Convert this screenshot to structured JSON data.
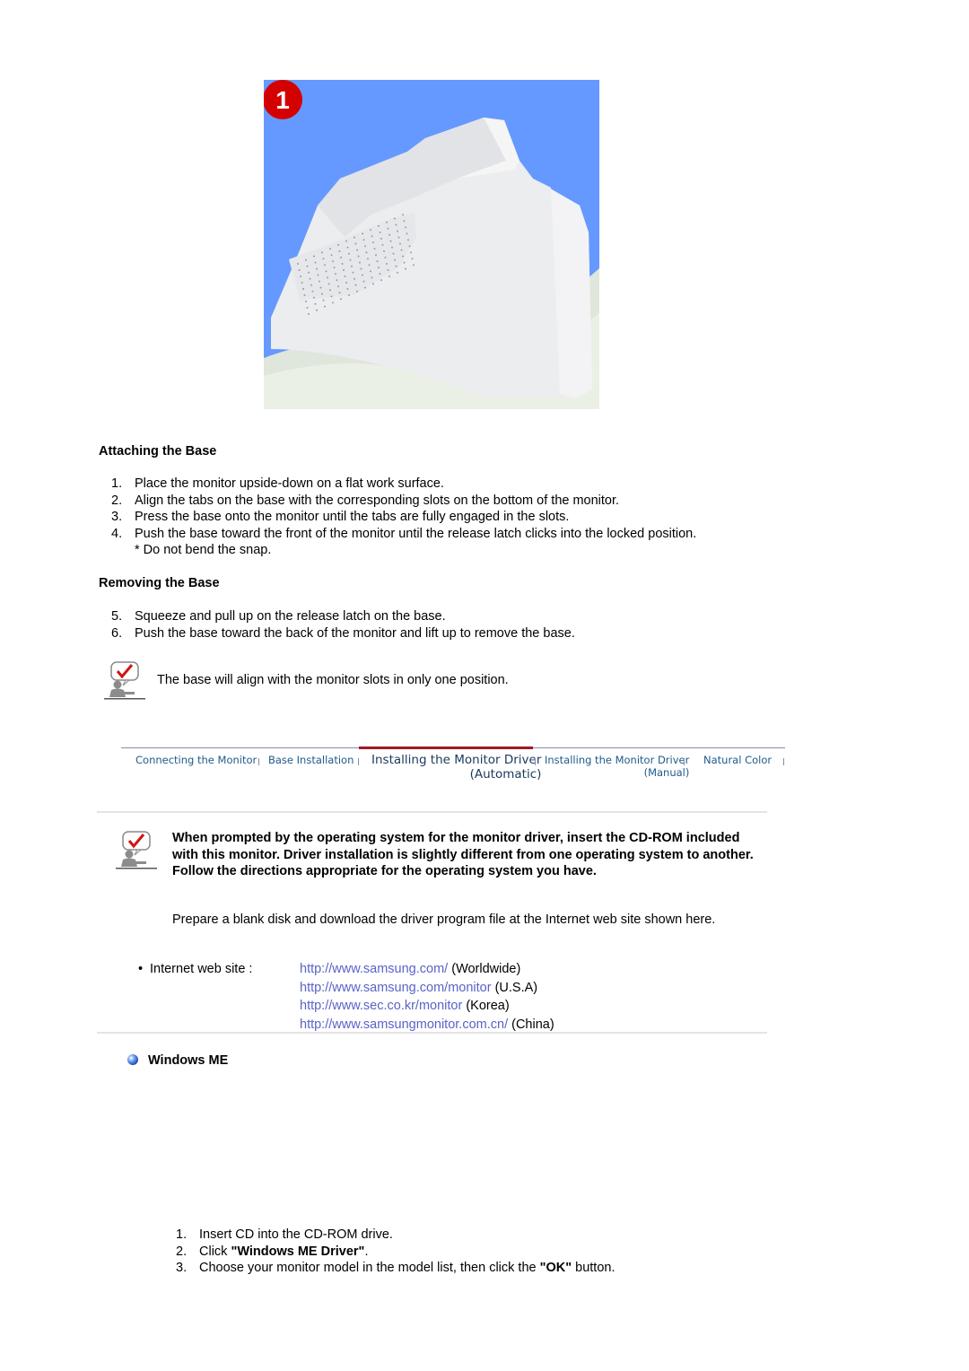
{
  "figure": {
    "step_badge": "1",
    "description": "Monitor side view resting on fluffy surface",
    "colors": {
      "background": "#6699ff",
      "badge": "#d40000"
    }
  },
  "attaching": {
    "heading": "Attaching the Base",
    "steps": [
      {
        "num": "1.",
        "text": "Place the monitor upside-down on a flat work surface."
      },
      {
        "num": "2.",
        "text": "Align the tabs on the base with the corresponding slots on the bottom of the monitor."
      },
      {
        "num": "3.",
        "text": "Press the base onto the monitor until the tabs are fully engaged in the slots."
      },
      {
        "num": "4.",
        "text": "Push the base toward the front of the monitor until the release latch clicks into the locked position.",
        "note": "* Do not bend the snap."
      }
    ]
  },
  "removing": {
    "heading": "Removing the Base",
    "steps": [
      {
        "num": "5.",
        "text": "Squeeze and pull up on the release latch on the base."
      },
      {
        "num": "6.",
        "text": "Push the base toward the back of the monitor and lift up to remove the base."
      }
    ]
  },
  "note1": {
    "icon": "checkmark-note-icon",
    "text": "The base will align with the monitor slots in only one position."
  },
  "nav": {
    "tabs": [
      {
        "label": "Connecting the Monitor",
        "sub": ""
      },
      {
        "label": "Base Installation",
        "sub": ""
      },
      {
        "label": "Installing the Monitor Driver",
        "sub": "(Automatic)",
        "active": true
      },
      {
        "label": "Installing the Monitor Driver",
        "sub": "(Manual)"
      },
      {
        "label": "Natural Color",
        "sub": ""
      }
    ],
    "colors": {
      "active_underline": "#a01822",
      "tab_text": "#1e5a8c"
    }
  },
  "driver": {
    "intro": "When prompted by the operating system for the monitor driver, insert the CD-ROM included with this monitor. Driver installation is slightly different from one operating system to another. Follow the directions appropriate for the operating system you have.",
    "prepare": "Prepare a blank disk and download the driver program file at the Internet web site shown here.",
    "sites_label": "Internet web site :",
    "sites": [
      {
        "url": "http://www.samsung.com/",
        "region": "(Worldwide)"
      },
      {
        "url": "http://www.samsung.com/monitor",
        "region": "(U.S.A)"
      },
      {
        "url": "http://www.sec.co.kr/monitor",
        "region": "(Korea)"
      },
      {
        "url": "http://www.samsungmonitor.com.cn/",
        "region": "(China)"
      }
    ],
    "link_color": "#5a63c8"
  },
  "windows_me": {
    "heading": "Windows ME",
    "steps": [
      {
        "num": "1.",
        "pre": "Insert CD into the CD-ROM drive.",
        "bold": "",
        "post": ""
      },
      {
        "num": "2.",
        "pre": "Click ",
        "bold": "\"Windows ME Driver\"",
        "post": "."
      },
      {
        "num": "3.",
        "pre": "Choose your monitor model in the model list, then click the ",
        "bold": "\"OK\"",
        "post": " button."
      }
    ]
  }
}
